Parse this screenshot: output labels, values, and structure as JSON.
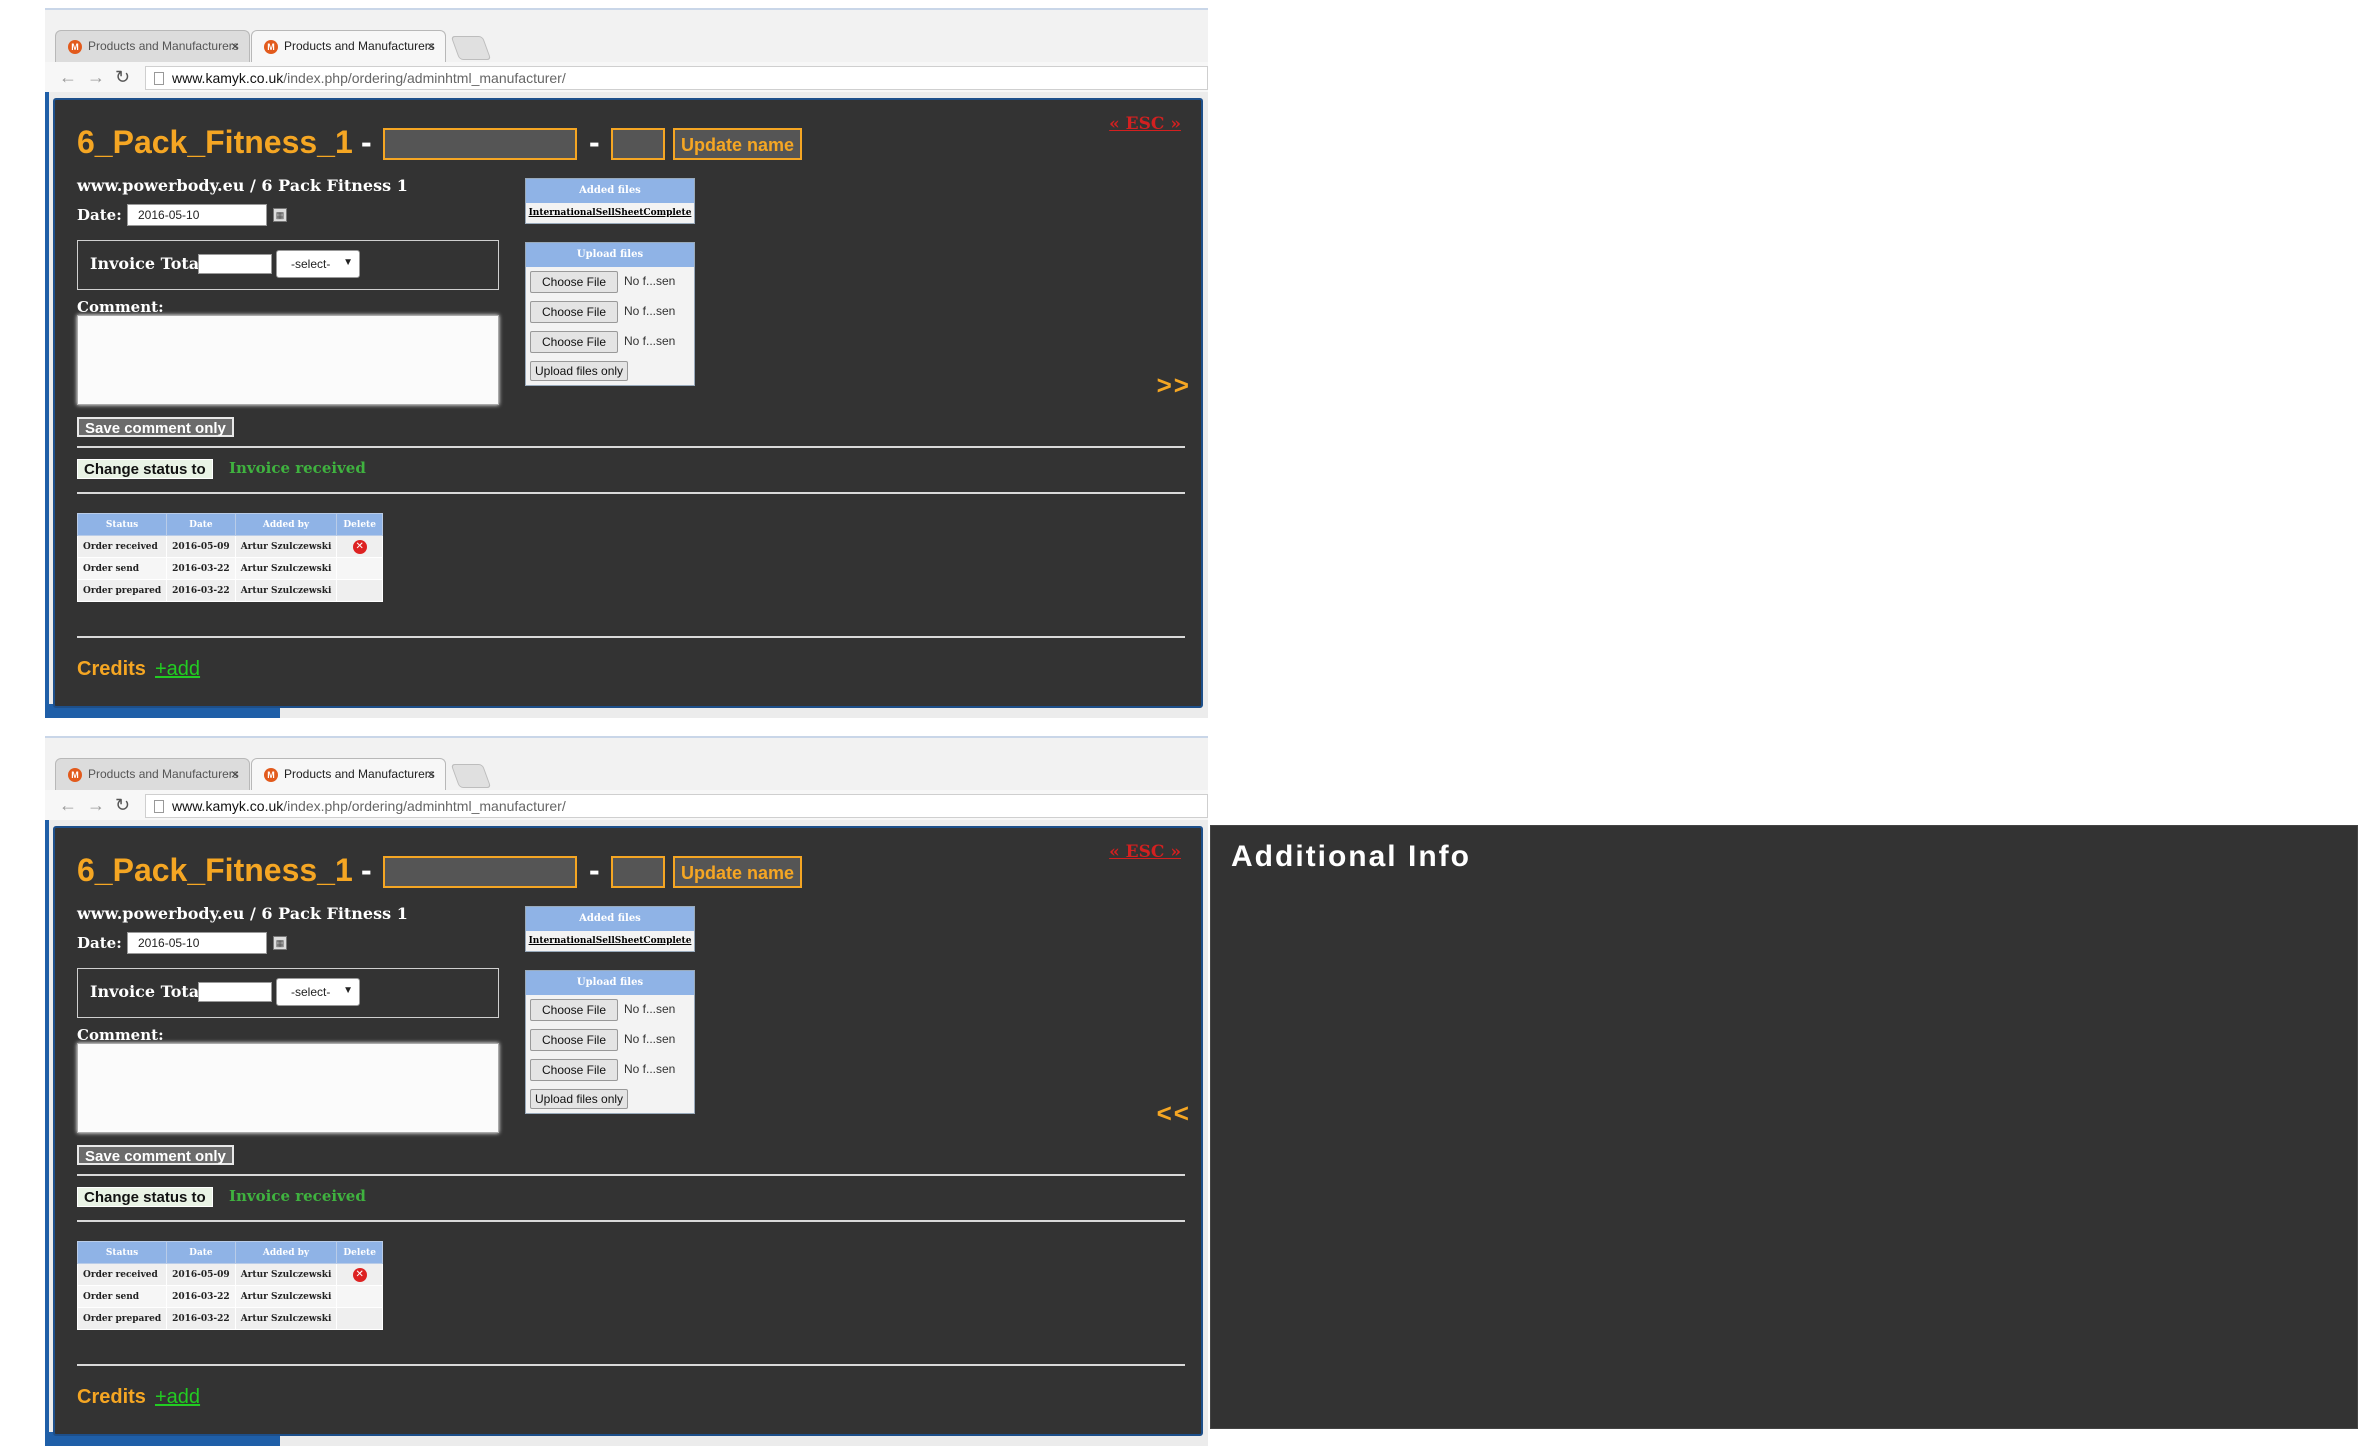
{
  "browser": {
    "tabs": [
      {
        "title": "Products and Manufacturers",
        "active": false
      },
      {
        "title": "Products and Manufacturers",
        "active": true
      }
    ],
    "url_host": "www.kamyk.co.uk",
    "url_path": "/index.php/ordering/adminhtml_manufacturer/"
  },
  "panel": {
    "esc_label": "« ESC »",
    "manufacturer_title": "6_Pack_Fitness_1",
    "separator": "-",
    "update_name_label": "Update name",
    "site_line": "www.powerbody.eu / 6 Pack Fitness 1",
    "date_label": "Date:",
    "date_value": "2016-05-10",
    "invoice_total_label": "Invoice Total:",
    "currency_select": "-select-",
    "comment_label": "Comment:",
    "save_comment_label": "Save comment only",
    "change_status_label": "Change status to",
    "next_status": "Invoice received",
    "status_table": {
      "headers": [
        "Status",
        "Date",
        "Added by",
        "Delete"
      ],
      "rows": [
        {
          "status": "Order received",
          "date": "2016-05-09",
          "added_by": "Artur Szulczewski",
          "deletable": true
        },
        {
          "status": "Order send",
          "date": "2016-03-22",
          "added_by": "Artur Szulczewski",
          "deletable": false
        },
        {
          "status": "Order prepared",
          "date": "2016-03-22",
          "added_by": "Artur Szulczewski",
          "deletable": false
        }
      ]
    },
    "credits_label": "Credits",
    "credits_add_label": "+add",
    "added_files_header": "Added files",
    "added_file_name": "InternationalSellSheetComplete",
    "upload_files_header": "Upload files",
    "choose_file_label": "Choose File",
    "no_file_label": "No f...sen",
    "upload_only_label": "Upload files only"
  },
  "shot1": {
    "toggle_label": ">>"
  },
  "shot2": {
    "toggle_label": "<<"
  },
  "additional_info": {
    "title": "Additional Info"
  },
  "colors": {
    "accent": "#f5a623",
    "panel_bg": "#333333",
    "status_green": "#3fb23f",
    "esc_red": "#d32020",
    "table_header": "#8fb3e6",
    "link_green": "#22cc22"
  }
}
